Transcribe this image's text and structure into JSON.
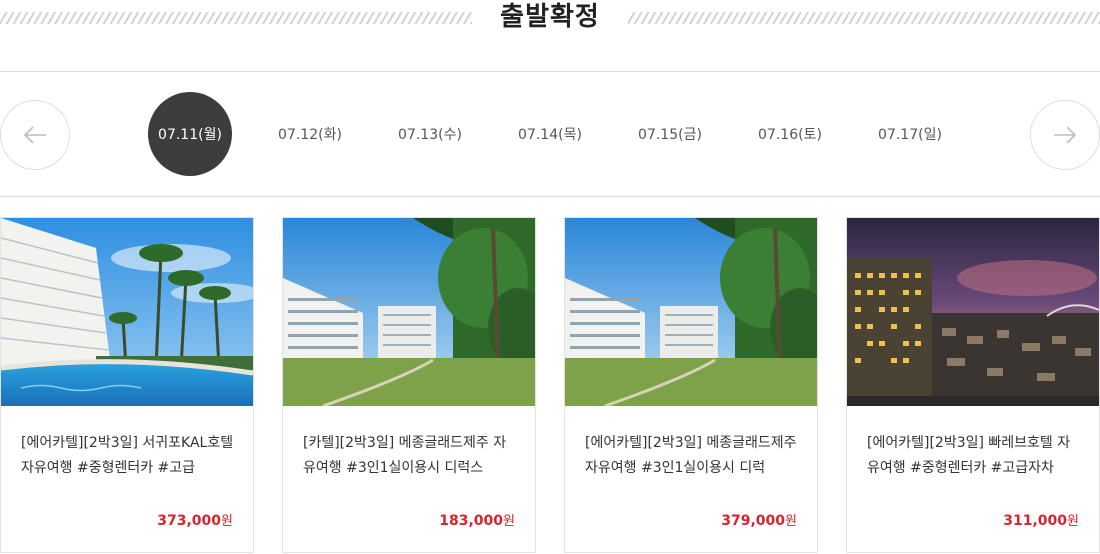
{
  "header": {
    "title": "출발확정"
  },
  "dates": [
    {
      "label": "07.11(월)",
      "active": true
    },
    {
      "label": "07.12(화)",
      "active": false
    },
    {
      "label": "07.13(수)",
      "active": false
    },
    {
      "label": "07.14(목)",
      "active": false
    },
    {
      "label": "07.15(금)",
      "active": false
    },
    {
      "label": "07.16(토)",
      "active": false
    },
    {
      "label": "07.17(일)",
      "active": false
    }
  ],
  "products": [
    {
      "name": "[에어카텔][2박3일] 서귀포KAL호텔 자유여행 #중형렌터카 #고급",
      "price": "373,000",
      "currency": "원",
      "image": "resort-pool-palms"
    },
    {
      "name": "[카텔][2박3일] 메종글래드제주 자유여행 #3인1실이용시 디럭스",
      "price": "183,000",
      "currency": "원",
      "image": "hotel-garden-lawn"
    },
    {
      "name": "[에어카텔][2박3일] 메종글래드제주 자유여행 #3인1실이용시 디럭",
      "price": "379,000",
      "currency": "원",
      "image": "hotel-garden-lawn"
    },
    {
      "name": "[에어카텔][2박3일] 빠레브호텔 자유여행 #중형렌터카 #고급자차",
      "price": "311,000",
      "currency": "원",
      "image": "hotel-night-city"
    }
  ],
  "colors": {
    "accent_price": "#d9232d",
    "active_date_bg": "#3d3d3d"
  }
}
